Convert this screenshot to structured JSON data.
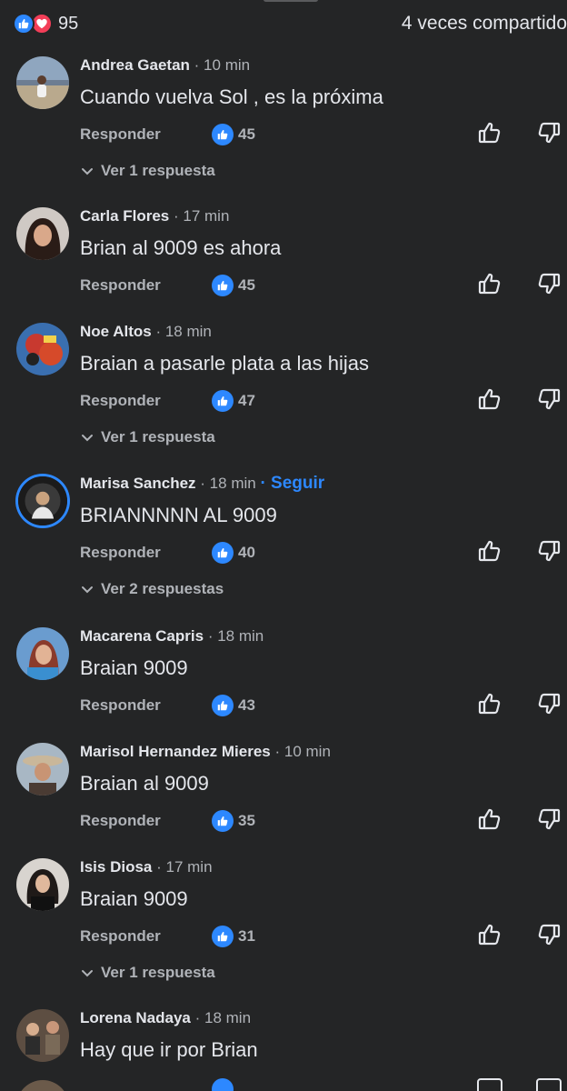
{
  "summary": {
    "reaction_count": "95",
    "shares": "4 veces compartido"
  },
  "labels": {
    "reply": "Responder"
  },
  "comments": [
    {
      "author": "Andrea Gaetan",
      "time": "· 10 min",
      "text": "Cuando vuelva Sol , es la próxima",
      "likes": "45",
      "replies": "Ver 1 respuesta"
    },
    {
      "author": "Carla Flores",
      "time": "· 17 min",
      "text": "Brian al 9009 es ahora",
      "likes": "45",
      "replies": ""
    },
    {
      "author": "Noe Altos",
      "time": "· 18 min",
      "text": "Braian a pasarle plata a las hijas",
      "likes": "47",
      "replies": "Ver 1 respuesta"
    },
    {
      "author": "Marisa Sanchez",
      "time": "· 18 min",
      "follow": "· Seguir",
      "text": "BRIANNNNN AL 9009",
      "likes": "40",
      "replies": "Ver 2 respuestas"
    },
    {
      "author": "Macarena Capris",
      "time": "· 18 min",
      "text": "Braian 9009",
      "likes": "43",
      "replies": ""
    },
    {
      "author": "Marisol Hernandez Mieres",
      "time": "· 10 min",
      "text": "Braian al 9009",
      "likes": "35",
      "replies": ""
    },
    {
      "author": "Isis Diosa",
      "time": "· 17 min",
      "text": "Braian 9009",
      "likes": "31",
      "replies": "Ver 1 respuesta"
    },
    {
      "author": "Lorena Nadaya",
      "time": "· 18 min",
      "text": "Hay que ir por Brian",
      "likes": "",
      "replies": ""
    }
  ],
  "colors": {
    "background": "#242526",
    "accent": "#2d88ff",
    "love": "#f33e58",
    "secondary_text": "#b0b3b8"
  },
  "icons": [
    "like-icon",
    "love-icon",
    "thumbs-up-icon",
    "thumbs-down-icon",
    "chevron-down-icon"
  ]
}
